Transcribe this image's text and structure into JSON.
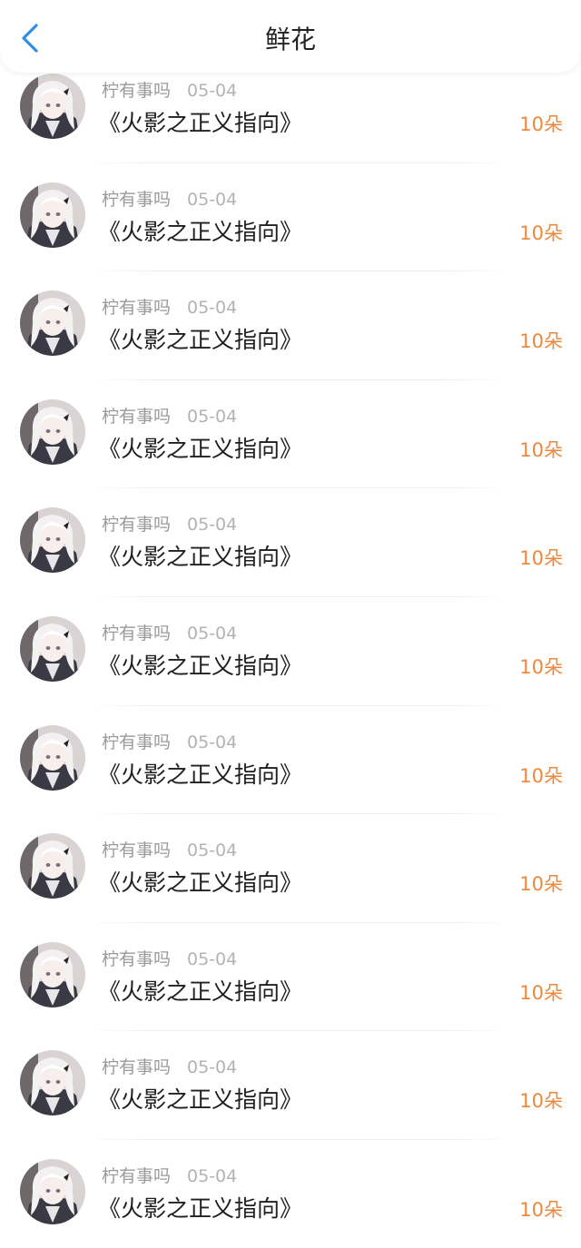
{
  "header": {
    "title": "鲜花",
    "back_icon": "chevron-left-icon",
    "accent_color": "#2f8fe6"
  },
  "colors": {
    "count": "#f0883a",
    "meta": "#9a9a9a",
    "title": "#1f1f1f"
  },
  "records": [
    {
      "user": "柠有事吗",
      "date": "05-04",
      "book": "《火影之正义指向》",
      "count": "10朵"
    },
    {
      "user": "柠有事吗",
      "date": "05-04",
      "book": "《火影之正义指向》",
      "count": "10朵"
    },
    {
      "user": "柠有事吗",
      "date": "05-04",
      "book": "《火影之正义指向》",
      "count": "10朵"
    },
    {
      "user": "柠有事吗",
      "date": "05-04",
      "book": "《火影之正义指向》",
      "count": "10朵"
    },
    {
      "user": "柠有事吗",
      "date": "05-04",
      "book": "《火影之正义指向》",
      "count": "10朵"
    },
    {
      "user": "柠有事吗",
      "date": "05-04",
      "book": "《火影之正义指向》",
      "count": "10朵"
    },
    {
      "user": "柠有事吗",
      "date": "05-04",
      "book": "《火影之正义指向》",
      "count": "10朵"
    },
    {
      "user": "柠有事吗",
      "date": "05-04",
      "book": "《火影之正义指向》",
      "count": "10朵"
    },
    {
      "user": "柠有事吗",
      "date": "05-04",
      "book": "《火影之正义指向》",
      "count": "10朵"
    },
    {
      "user": "柠有事吗",
      "date": "05-04",
      "book": "《火影之正义指向》",
      "count": "10朵"
    },
    {
      "user": "柠有事吗",
      "date": "05-04",
      "book": "《火影之正义指向》",
      "count": "10朵"
    }
  ]
}
